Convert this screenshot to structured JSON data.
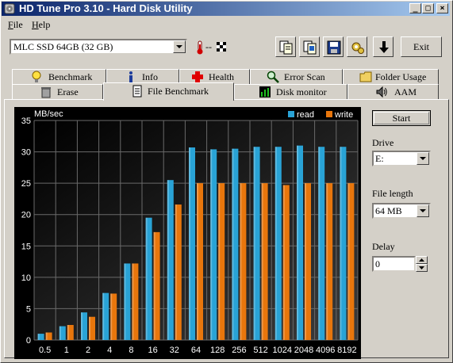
{
  "window": {
    "title": "HD Tune Pro 3.10 - Hard Disk Utility"
  },
  "title_buttons": {
    "minimize": "_",
    "maximize": "□",
    "close": "×"
  },
  "menu": [
    {
      "label": "File",
      "accel": "F",
      "rest": "ile"
    },
    {
      "label": "Help",
      "accel": "H",
      "rest": "elp"
    }
  ],
  "drive_select": {
    "value": "MLC SSD 64GB (32 GB)"
  },
  "temperature": {
    "value": "--"
  },
  "toolbar": {
    "icons": [
      "copy-info-icon",
      "copy-screenshot-icon",
      "save-icon",
      "options-icon",
      "download-icon"
    ],
    "exit_label": "Exit"
  },
  "tabs_top": [
    {
      "label": "Benchmark",
      "icon": "bulb-icon"
    },
    {
      "label": "Info",
      "icon": "info-icon"
    },
    {
      "label": "Health",
      "icon": "health-cross-icon"
    },
    {
      "label": "Error Scan",
      "icon": "magnifier-icon"
    },
    {
      "label": "Folder Usage",
      "icon": "folder-icon"
    }
  ],
  "tabs_bottom": [
    {
      "label": "Erase",
      "icon": "trash-icon"
    },
    {
      "label": "File Benchmark",
      "icon": "document-icon",
      "active": true
    },
    {
      "label": "Disk monitor",
      "icon": "bar-chart-icon"
    },
    {
      "label": "AAM",
      "icon": "speaker-icon"
    }
  ],
  "sidebar": {
    "start_label": "Start",
    "drive_label": "Drive",
    "drive_value": "E:",
    "file_length_label": "File length",
    "file_length_value": "64 MB",
    "delay_label": "Delay",
    "delay_value": "0"
  },
  "colors": {
    "read": "#29a3d6",
    "write": "#e8760c",
    "grid": "#6a6a6a",
    "text": "#ffffff"
  },
  "chart_data": {
    "type": "bar",
    "ylabel": "MB/sec",
    "ylim": [
      0,
      35
    ],
    "yticks": [
      "0",
      "5",
      "10",
      "15",
      "20",
      "25",
      "30",
      "35"
    ],
    "categories": [
      "0.5",
      "1",
      "2",
      "4",
      "8",
      "16",
      "32",
      "64",
      "128",
      "256",
      "512",
      "1024",
      "2048",
      "4096",
      "8192"
    ],
    "legend_position": "top-right",
    "grid": true,
    "series": [
      {
        "name": "read",
        "values": [
          1.0,
          2.2,
          4.4,
          7.5,
          12.2,
          19.5,
          25.5,
          30.7,
          30.4,
          30.5,
          30.8,
          30.8,
          31.0,
          30.8,
          30.8
        ]
      },
      {
        "name": "write",
        "values": [
          1.2,
          2.4,
          3.7,
          7.4,
          12.2,
          17.2,
          21.6,
          25.0,
          25.0,
          25.0,
          25.0,
          24.7,
          25.0,
          25.0,
          25.0
        ]
      }
    ]
  }
}
